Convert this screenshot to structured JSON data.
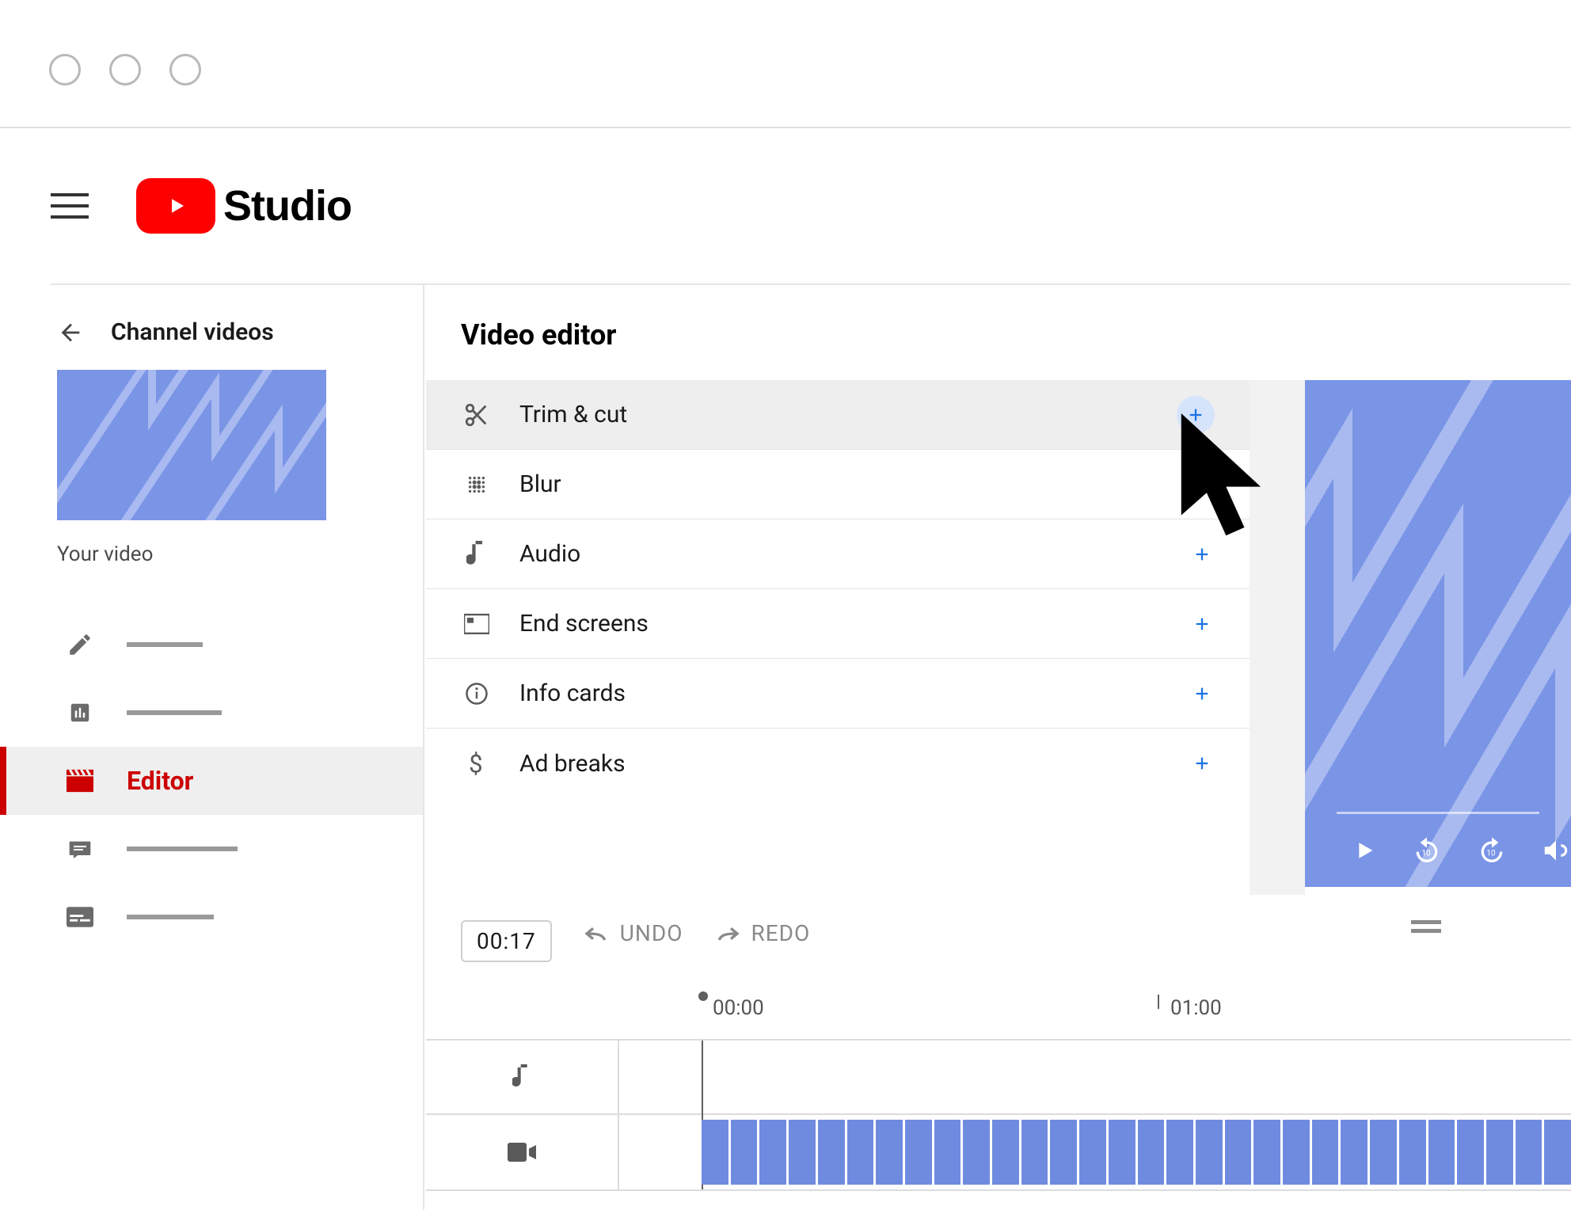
{
  "header": {
    "app_name": "Studio"
  },
  "sidebar": {
    "back_label": "Channel videos",
    "thumbnail_label": "Your video",
    "items": [
      {
        "icon": "pencil-icon"
      },
      {
        "icon": "analytics-icon"
      },
      {
        "icon": "clapper-icon",
        "label": "Editor",
        "active": true
      },
      {
        "icon": "comments-icon"
      },
      {
        "icon": "subtitles-icon"
      }
    ]
  },
  "main": {
    "title": "Video editor",
    "tools": [
      {
        "icon": "scissors-icon",
        "label": "Trim & cut",
        "hovered": true
      },
      {
        "icon": "blur-icon",
        "label": "Blur"
      },
      {
        "icon": "music-note-icon",
        "label": "Audio"
      },
      {
        "icon": "endscreen-icon",
        "label": "End screens"
      },
      {
        "icon": "info-icon",
        "label": "Info cards"
      },
      {
        "icon": "dollar-icon",
        "label": "Ad breaks"
      }
    ]
  },
  "preview": {
    "controls": [
      "play-icon",
      "replay10-icon",
      "forward10-icon",
      "volume-icon"
    ]
  },
  "timeline": {
    "current_time": "00:17",
    "undo_label": "UNDO",
    "redo_label": "REDO",
    "ruler": [
      {
        "time": "00:00",
        "pos": 350
      },
      {
        "time": "01:00",
        "pos": 930
      }
    ],
    "tracks": [
      {
        "icon": "music-note-icon"
      },
      {
        "icon": "video-cam-icon"
      }
    ]
  }
}
